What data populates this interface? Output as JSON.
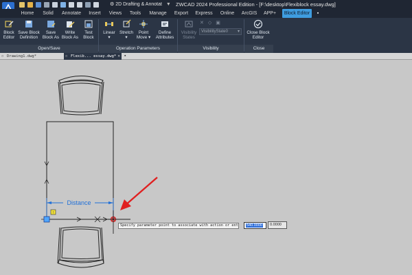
{
  "titlebar": {
    "workspace": "2D Drafting & Annotat",
    "workspace_arrow": "▼",
    "app_title": "ZWCAD 2024 Professional Edition - [F:\\desktop\\Flexiblock essay.dwg]"
  },
  "tabs": [
    "Home",
    "Solid",
    "Annotate",
    "Insert",
    "Views",
    "Tools",
    "Manage",
    "Export",
    "Express",
    "Online",
    "ArcGIS",
    "APP+",
    "Block Editor"
  ],
  "ribbon": {
    "buttons": [
      {
        "label": "Block\nEditor"
      },
      {
        "label": "Save Block\nDefinition"
      },
      {
        "label": "Save\nBlock As"
      },
      {
        "label": "Write\nBlock As"
      },
      {
        "label": "Test\nBlock"
      },
      {
        "label": "Linear\n▾"
      },
      {
        "label": "Stretch\n▾"
      },
      {
        "label": "Point\nMove ▾"
      },
      {
        "label": "Define\nAttributes"
      },
      {
        "label": "Visibility\nStates"
      },
      {
        "label": "Close Block\nEditor"
      }
    ],
    "visibility_state": "VisibilityState0",
    "groups": [
      "Open/Save",
      "Operation Parameters",
      "Visibility",
      "Close"
    ]
  },
  "doctabs": [
    {
      "label": "Drawing1.dwg*"
    },
    {
      "label": "Flexib... essay.dwg*"
    }
  ],
  "canvas": {
    "parameter_label": "Distance",
    "prompt": "Specify parameter point to associate with action or enter",
    "coord_x": "540.0000",
    "coord_y": "0.0000"
  },
  "colors": {
    "accent": "#3f9de0",
    "background": "#c8c8c8",
    "parameter": "#1f6fd8",
    "arrow": "#e02020"
  }
}
